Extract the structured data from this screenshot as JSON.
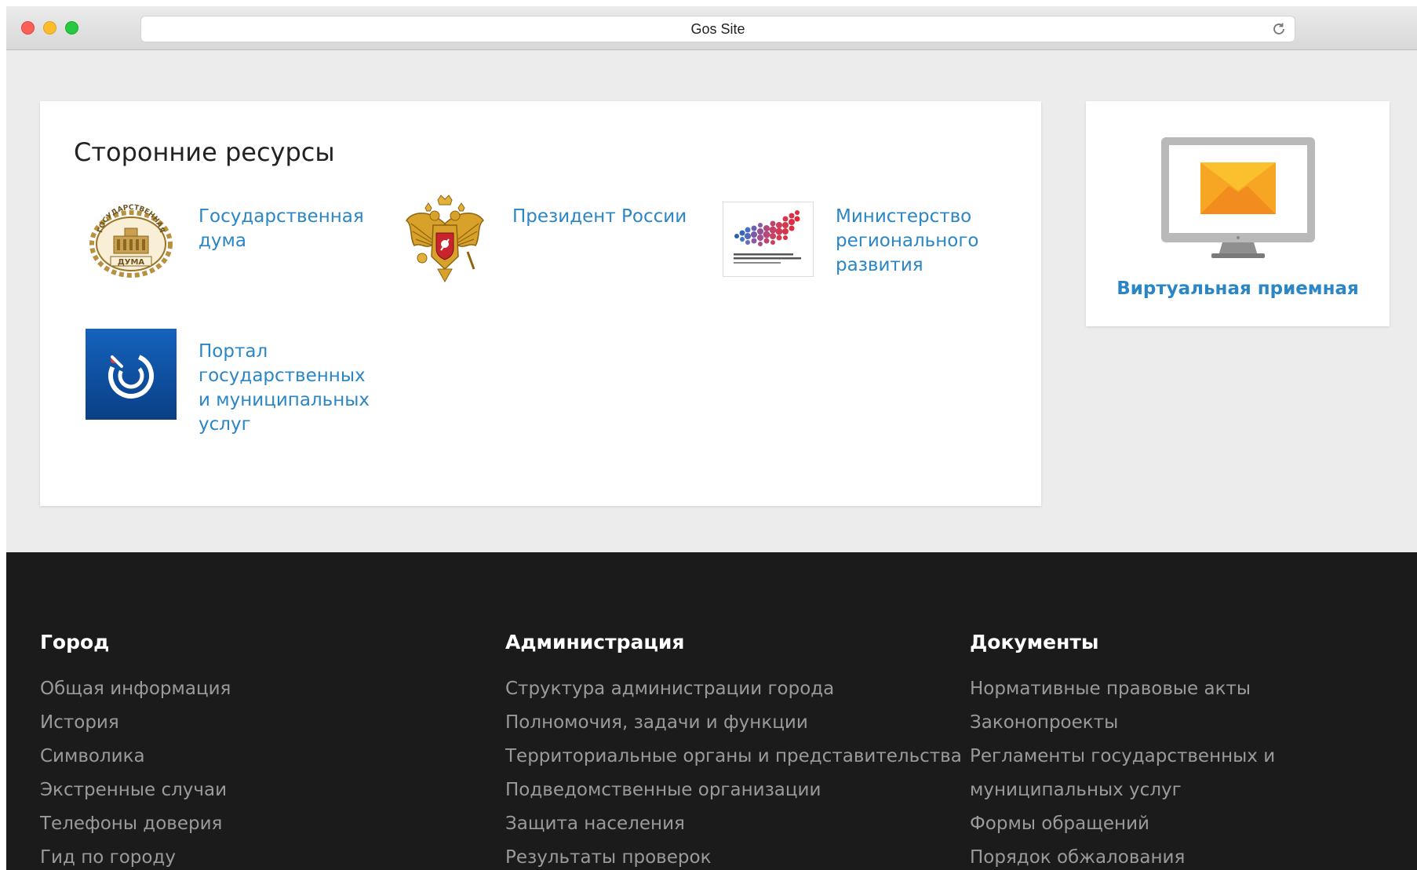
{
  "browser": {
    "url_title": "Gos Site"
  },
  "resources": {
    "title": "Сторонние ресурсы",
    "items": [
      {
        "label": "Государственная дума",
        "icon": "state-duma-emblem-icon"
      },
      {
        "label": "Президент России",
        "icon": "russian-coat-of-arms-icon"
      },
      {
        "label": "Министерство регионального развития",
        "icon": "ministry-regional-development-logo-icon"
      },
      {
        "label": "Портал государственных и муниципальных услуг",
        "icon": "gosuslugi-portal-icon"
      }
    ],
    "duma_emblem_text_top": "ГОСУДАРСТВЕННАЯ",
    "duma_emblem_text_bottom": "ДУМА"
  },
  "reception": {
    "label": "Виртуальная приемная",
    "icon": "monitor-envelope-icon"
  },
  "colors": {
    "link": "#2b86c5",
    "footer_bg": "#1b1b1b",
    "envelope": "#f6a623",
    "gosuslugi_blue": "#0c4fa0"
  },
  "footer": {
    "columns": [
      {
        "title": "Город",
        "links": [
          "Общая информация",
          "История",
          "Символика",
          "Экстренные случаи",
          "Телефоны доверия",
          "Гид по городу"
        ]
      },
      {
        "title": "Администрация",
        "links": [
          "Структура администрации города",
          "Полномочия, задачи и функции",
          "Территориальные органы и представительства",
          "Подведомственные организации",
          "Защита населения",
          "Результаты проверок"
        ]
      },
      {
        "title": "Документы",
        "links": [
          "Нормативные правовые акты",
          "Законопроекты",
          "Регламенты государственных и",
          "муниципальных услуг",
          "Формы обращений",
          "Порядок обжалования"
        ]
      }
    ]
  }
}
